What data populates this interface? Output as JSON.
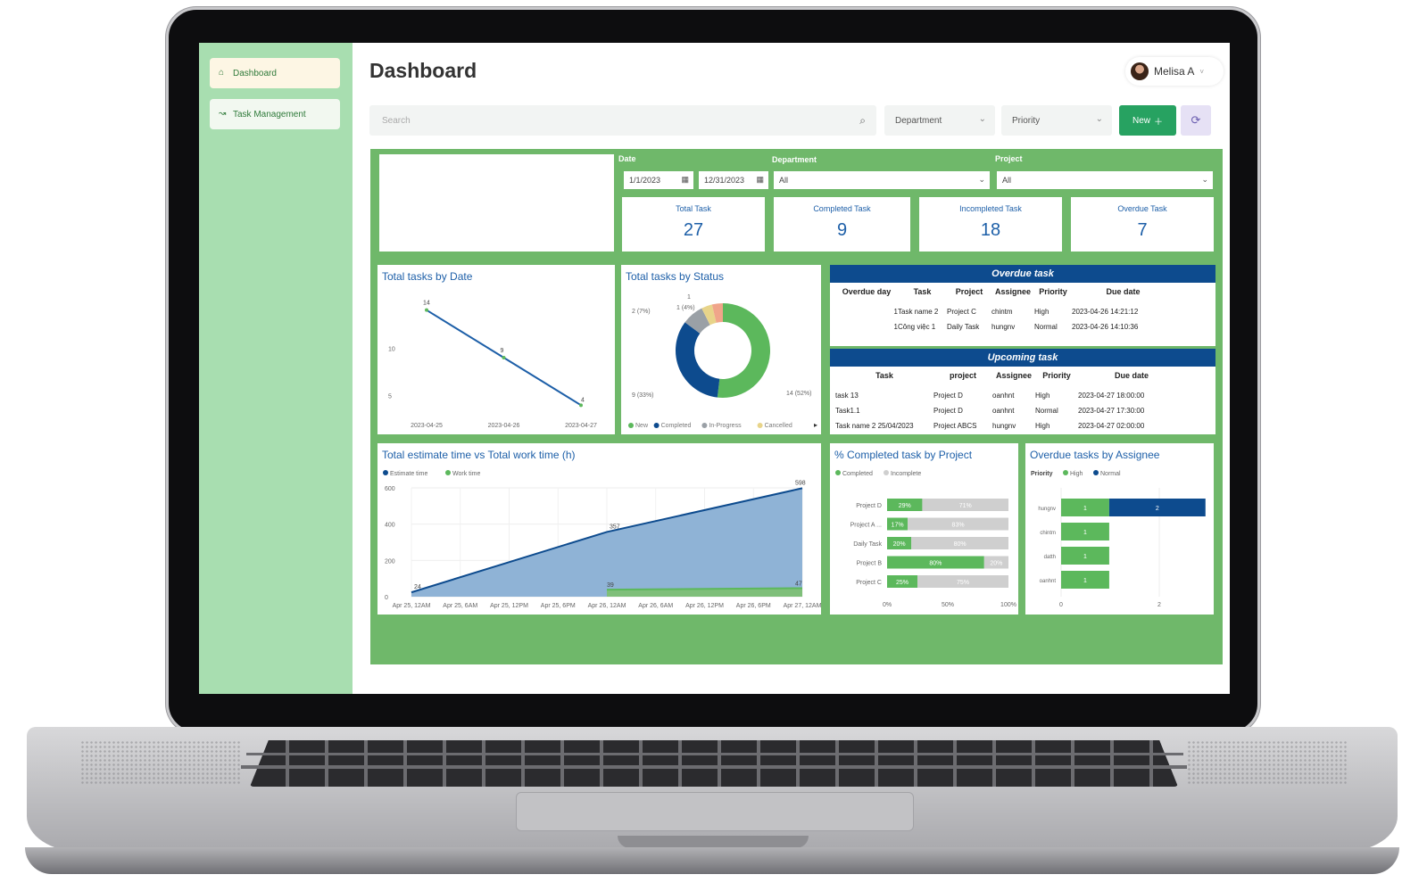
{
  "sidebar": {
    "items": [
      {
        "label": "Dashboard",
        "icon": "home-icon"
      },
      {
        "label": "Task Management",
        "icon": "task-icon"
      }
    ]
  },
  "header": {
    "title": "Dashboard",
    "user_name": "Melisa A"
  },
  "toolbar": {
    "search_placeholder": "Search",
    "department_label": "Department",
    "priority_label": "Priority",
    "new_label": "New"
  },
  "filters": {
    "date_label": "Date",
    "date_from": "1/1/2023",
    "date_to": "12/31/2023",
    "department_label": "Department",
    "department_value": "All",
    "project_label": "Project",
    "project_value": "All"
  },
  "kpis": [
    {
      "title": "Total Task",
      "value": "27"
    },
    {
      "title": "Completed Task",
      "value": "9"
    },
    {
      "title": "Incompleted Task",
      "value": "18"
    },
    {
      "title": "Overdue Task",
      "value": "7"
    }
  ],
  "chart_data": [
    {
      "type": "line",
      "title": "Total tasks by Date",
      "x": [
        "2023-04-25",
        "2023-04-26",
        "2023-04-27"
      ],
      "values": [
        14,
        9,
        4
      ],
      "y_ticks": [
        "10",
        "5"
      ],
      "ylim": [
        3,
        15
      ],
      "color": "#1d5fa8"
    },
    {
      "type": "pie",
      "title": "Total tasks by Status",
      "slices": [
        {
          "name": "New",
          "value": 14,
          "label": "14 (52%)",
          "color": "#5cb85c"
        },
        {
          "name": "Completed",
          "value": 9,
          "label": "9 (33%)",
          "color": "#0d4b8e"
        },
        {
          "name": "In-Progress",
          "value": 2,
          "label": "2 (7%)",
          "color": "#9aa0a6"
        },
        {
          "name": "Cancelled",
          "value": 1,
          "label": "1 (4%)",
          "color": "#e8d48a"
        },
        {
          "name": "",
          "value": 1,
          "label": "1",
          "color": "#f0a58a"
        }
      ]
    },
    {
      "type": "area",
      "title": "Total estimate time vs Total work time (h)",
      "x": [
        "Apr 25, 12AM",
        "Apr 25, 6AM",
        "Apr 25, 12PM",
        "Apr 25, 6PM",
        "Apr 26, 12AM",
        "Apr 26, 6AM",
        "Apr 26, 12PM",
        "Apr 26, 6PM",
        "Apr 27, 12AM"
      ],
      "y_ticks": [
        "600",
        "400",
        "200",
        "0"
      ],
      "ylim": [
        0,
        600
      ],
      "series": [
        {
          "name": "Estimate time",
          "color": "#0d4b8e",
          "points": [
            [
              0,
              24
            ],
            [
              4,
              357
            ],
            [
              8,
              598
            ]
          ],
          "labels": [
            "24",
            "357",
            "598"
          ]
        },
        {
          "name": "Work time",
          "color": "#5cb85c",
          "points": [
            [
              4,
              39
            ],
            [
              8,
              47
            ]
          ],
          "labels": [
            "39",
            "47"
          ]
        }
      ]
    },
    {
      "type": "bar",
      "title": "% Completed task by Project",
      "legend": [
        "Completed",
        "Incomplete"
      ],
      "categories": [
        "Project D",
        "Project A ...",
        "Daily Task",
        "Project B",
        "Project C"
      ],
      "series": [
        {
          "name": "Completed",
          "values": [
            29,
            17,
            20,
            80,
            25
          ],
          "color": "#5cb85c"
        },
        {
          "name": "Incomplete",
          "values": [
            71,
            83,
            80,
            20,
            75
          ],
          "color": "#cfcfcf"
        }
      ],
      "labels_completed": [
        "29%",
        "17%",
        "20%",
        "80%",
        "25%"
      ],
      "labels_incomplete": [
        "71%",
        "83%",
        "80%",
        "20%",
        "75%"
      ],
      "x_ticks": [
        "0%",
        "50%",
        "100%"
      ]
    },
    {
      "type": "bar",
      "title": "Overdue tasks by Assignee",
      "legend_title": "Priority",
      "legend": [
        "High",
        "Normal"
      ],
      "categories": [
        "hungnv",
        "chintm",
        "datth",
        "oanhnt"
      ],
      "series": [
        {
          "name": "High",
          "values": [
            1,
            1,
            1,
            1
          ],
          "color": "#5cb85c"
        },
        {
          "name": "Normal",
          "values": [
            2,
            0,
            0,
            0
          ],
          "color": "#0d4b8e"
        }
      ],
      "x_ticks": [
        "0",
        "2"
      ]
    }
  ],
  "overdue": {
    "title": "Overdue task",
    "columns": [
      "Overdue day",
      "Task",
      "Project",
      "Assignee",
      "Priority",
      "Due date"
    ],
    "rows": [
      [
        "1",
        "Task name 2",
        "Project C",
        "chintm",
        "High",
        "2023-04-26 14:21:12"
      ],
      [
        "1",
        "Công việc 1",
        "Daily Task",
        "hungnv",
        "Normal",
        "2023-04-26 14:10:36"
      ]
    ]
  },
  "upcoming": {
    "title": "Upcoming task",
    "columns": [
      "Task",
      "project",
      "Assignee",
      "Priority",
      "Due date"
    ],
    "rows": [
      [
        "task 13",
        "Project D",
        "oanhnt",
        "High",
        "2023-04-27 18:00:00"
      ],
      [
        "Task1.1",
        "Project D",
        "oanhnt",
        "Normal",
        "2023-04-27 17:30:00"
      ],
      [
        "Task name 2 25/04/2023",
        "Project ABCS",
        "hungnv",
        "High",
        "2023-04-27 02:00:00"
      ]
    ]
  },
  "colors": {
    "accent_green": "#6fb86a",
    "sidebar": "#a8deb0",
    "primary_blue": "#1d5fa8",
    "new_button": "#27a261"
  }
}
